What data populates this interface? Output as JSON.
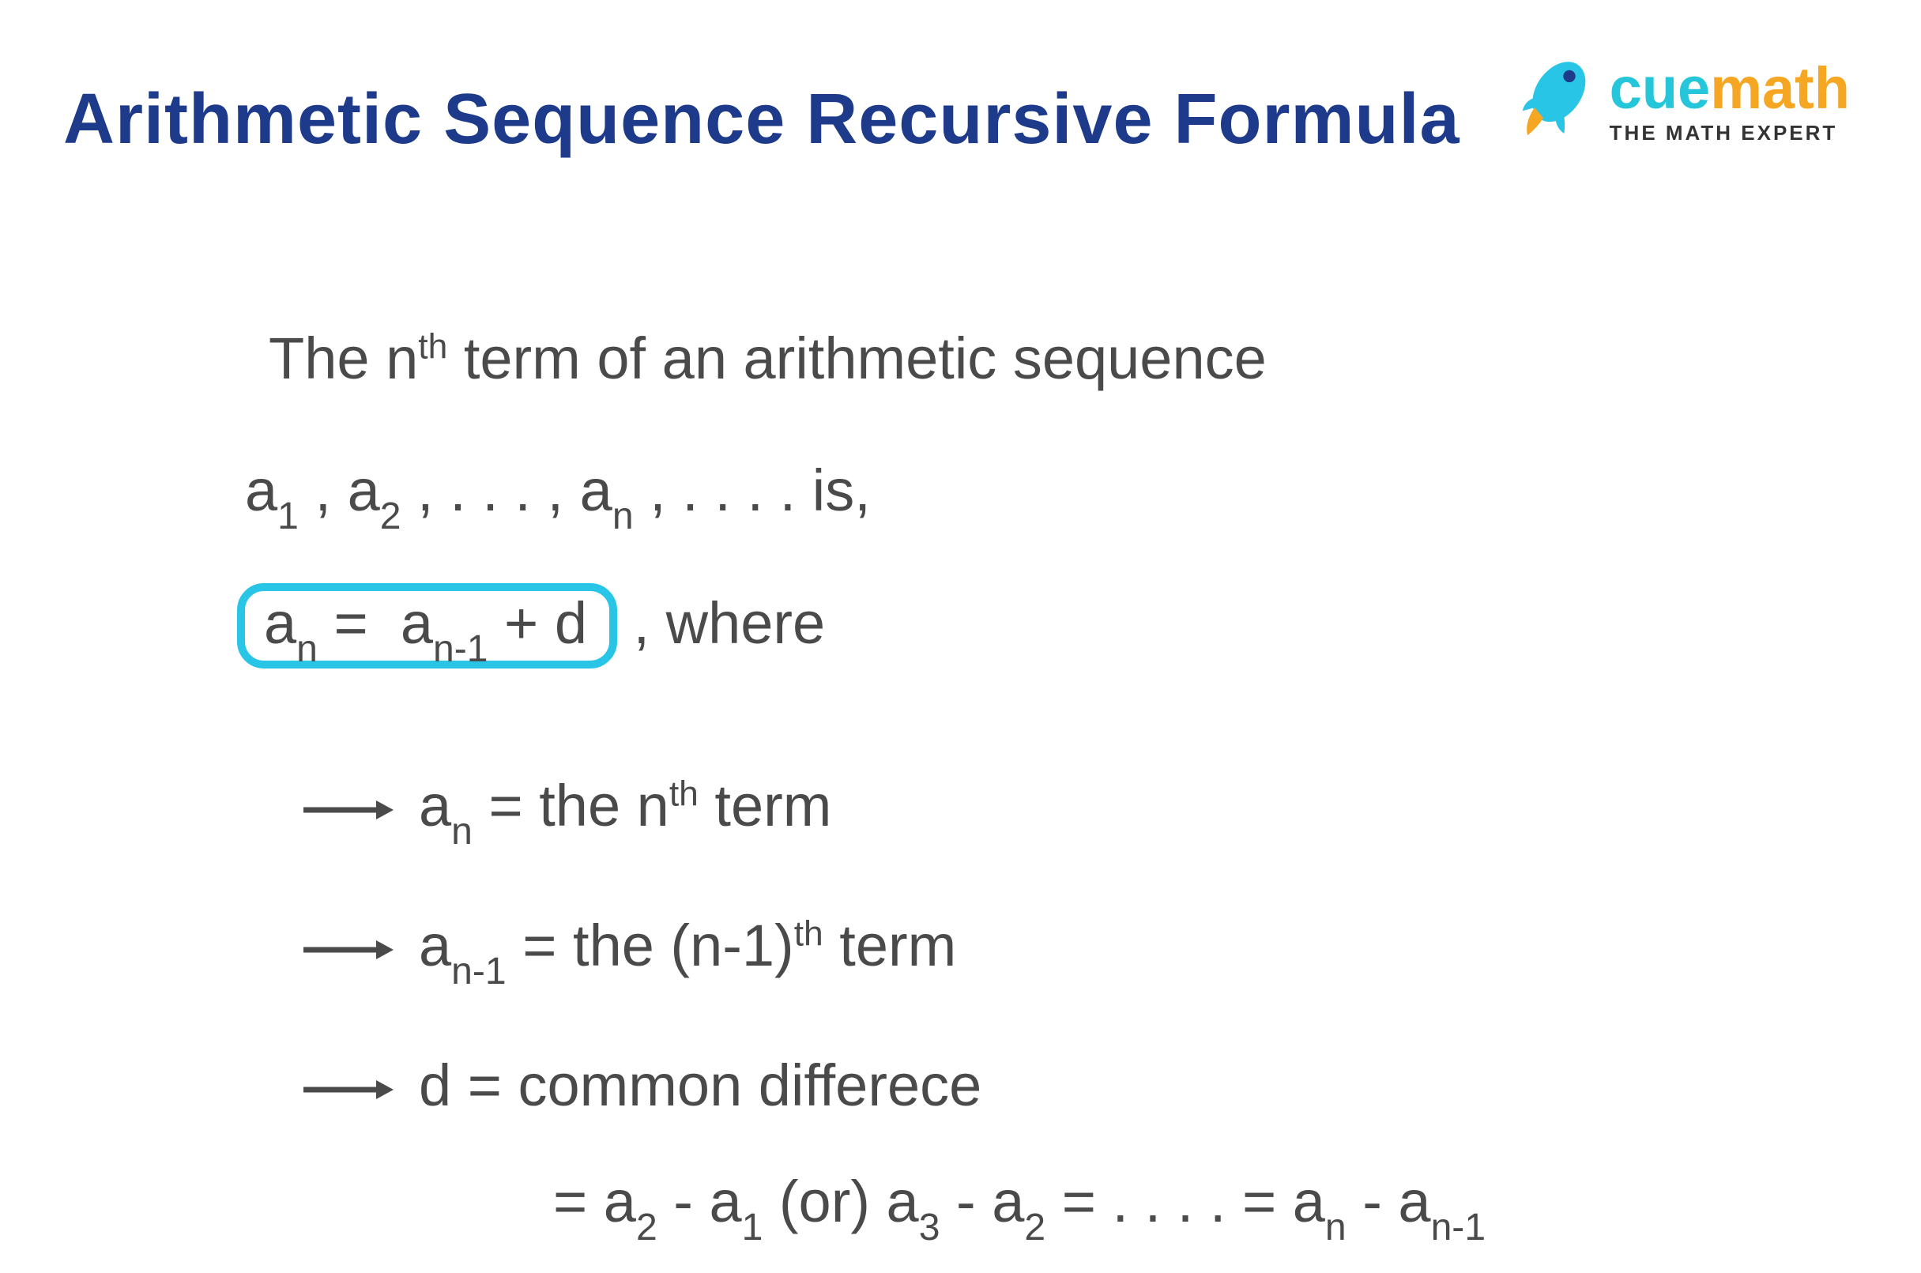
{
  "title": "Arithmetic Sequence Recursive Formula",
  "logo": {
    "brand_first": "cue",
    "brand_last": "math",
    "tagline": "THE MATH EXPERT"
  },
  "line1_pre": "The n",
  "line1_sup": "th",
  "line1_post": " term of an arithmetic sequence",
  "seq": {
    "a": "a",
    "s1": "1",
    "s2": "2",
    "sn": "n",
    "comma": " , ",
    "dots3": " . . . ",
    "dots4": " . . . . ",
    "is": "  is,"
  },
  "formula": {
    "a": "a",
    "sn": "n",
    "eq": " = ",
    "snm1": "n-1",
    "plus_d": " + d",
    "where": " ,  where"
  },
  "defs": {
    "an_lhs_a": "a",
    "an_lhs_sub": "n",
    "an_eq": " =  the n",
    "an_sup": "th",
    "an_post": " term",
    "anm1_lhs_a": "a",
    "anm1_lhs_sub": "n-1",
    "anm1_eq": "  =  the (n-1)",
    "anm1_sup": "th",
    "anm1_post": " term",
    "d_lhs": "d  =  common differece",
    "d2_pre": "=  a",
    "d2_s2": "2",
    "d2_m1": " - a",
    "d2_s1": "1",
    "d2_or": " (or) a",
    "d2_s3": "3",
    "d2_m2": " - a",
    "d2_s2b": "2",
    "d2_dots": " = . . . . =  a",
    "d2_sn": "n",
    "d2_last": " - a",
    "d2_snm1": "n-1"
  }
}
